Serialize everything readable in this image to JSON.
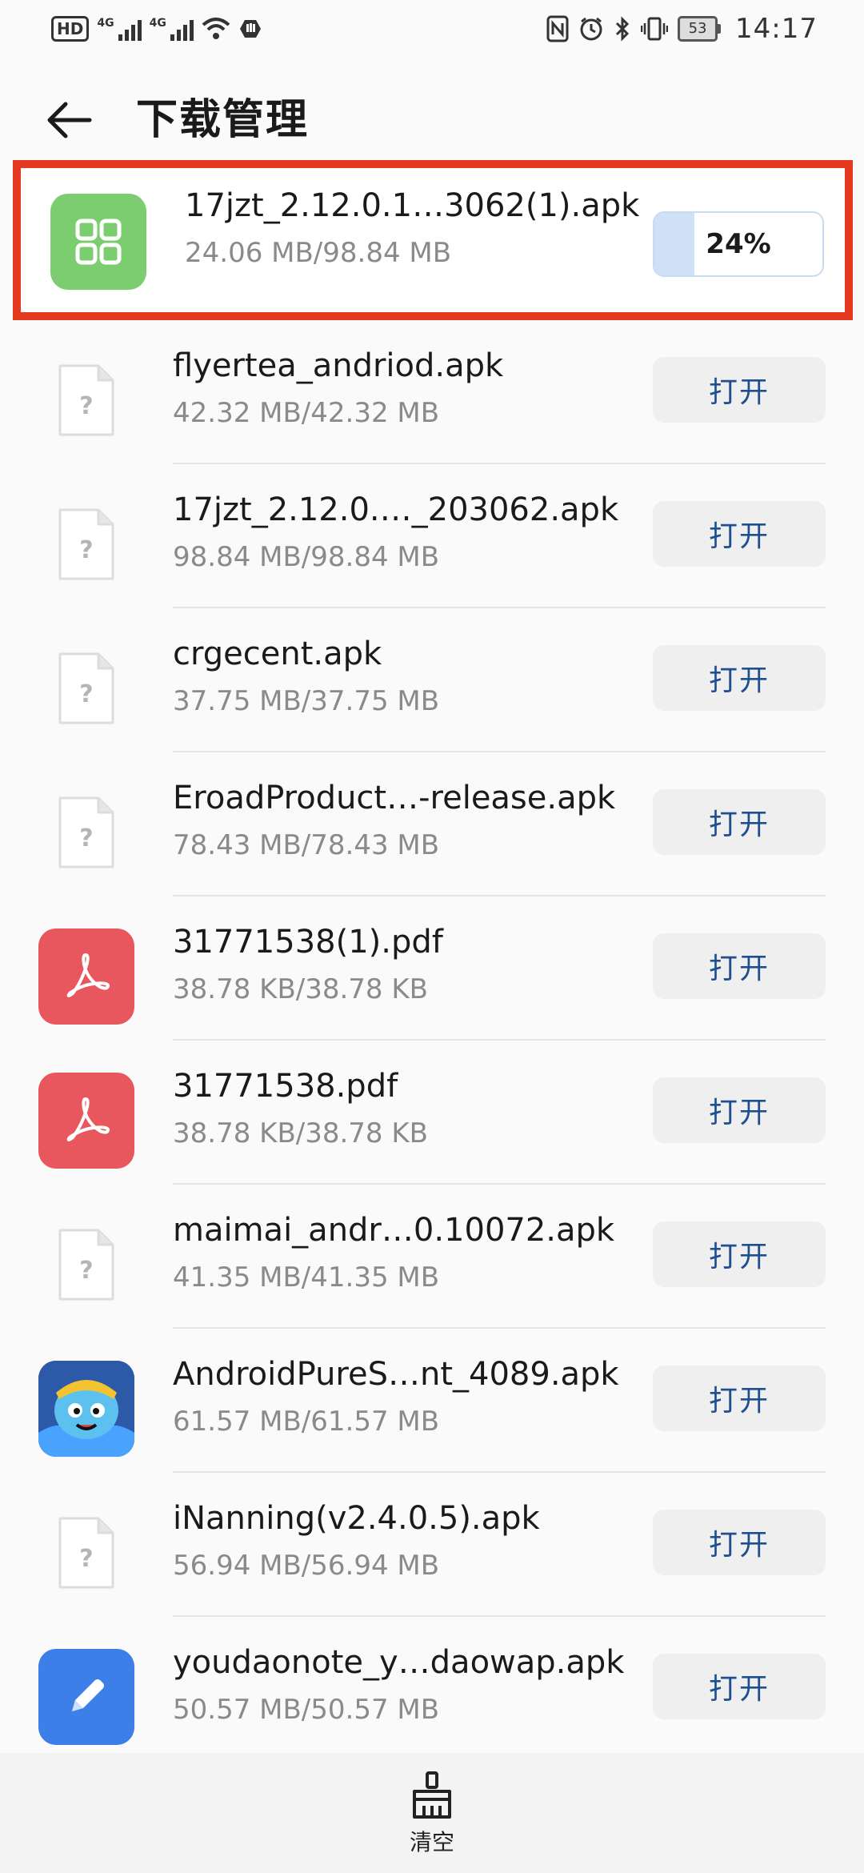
{
  "status_bar": {
    "hd_label": "HD",
    "net1": "4G",
    "net2": "4G",
    "battery": "53",
    "time": "14:17"
  },
  "header": {
    "title": "下载管理",
    "back_icon": "arrow-left-icon"
  },
  "active_download": {
    "name": "17jzt_2.12.0.1…3062(1).apk",
    "size": "24.06 MB/98.84 MB",
    "progress_label": "24%",
    "progress": 0.24,
    "icon": "app-grid-icon",
    "icon_color": "#7ccd6f"
  },
  "open_label": "打开",
  "downloads": [
    {
      "name": "flyertea_andriod.apk",
      "size": "42.32 MB/42.32 MB",
      "icon": "unknown-file-icon"
    },
    {
      "name": "17jzt_2.12.0.…_203062.apk",
      "size": "98.84 MB/98.84 MB",
      "icon": "unknown-file-icon"
    },
    {
      "name": "crgecent.apk",
      "size": "37.75 MB/37.75 MB",
      "icon": "unknown-file-icon"
    },
    {
      "name": "EroadProduct…-release.apk",
      "size": "78.43 MB/78.43 MB",
      "icon": "unknown-file-icon"
    },
    {
      "name": "31771538(1).pdf",
      "size": "38.78 KB/38.78 KB",
      "icon": "pdf-icon"
    },
    {
      "name": "31771538.pdf",
      "size": "38.78 KB/38.78 KB",
      "icon": "pdf-icon"
    },
    {
      "name": "maimai_andr…0.10072.apk",
      "size": "41.35 MB/41.35 MB",
      "icon": "unknown-file-icon"
    },
    {
      "name": "AndroidPureS…nt_4089.apk",
      "size": "61.57 MB/61.57 MB",
      "icon": "app-character-icon"
    },
    {
      "name": "iNanning(v2.4.0.5).apk",
      "size": "56.94 MB/56.94 MB",
      "icon": "unknown-file-icon"
    },
    {
      "name": "youdaonote_y…daowap.apk",
      "size": "50.57 MB/50.57 MB",
      "icon": "note-pen-icon"
    }
  ],
  "bottom_bar": {
    "clear_label": "清空",
    "clear_icon": "broom-icon"
  },
  "colors": {
    "highlight_border": "#e63a20",
    "open_text": "#1e4f8f",
    "pdf": "#e7575d",
    "note": "#3d7fe8"
  }
}
